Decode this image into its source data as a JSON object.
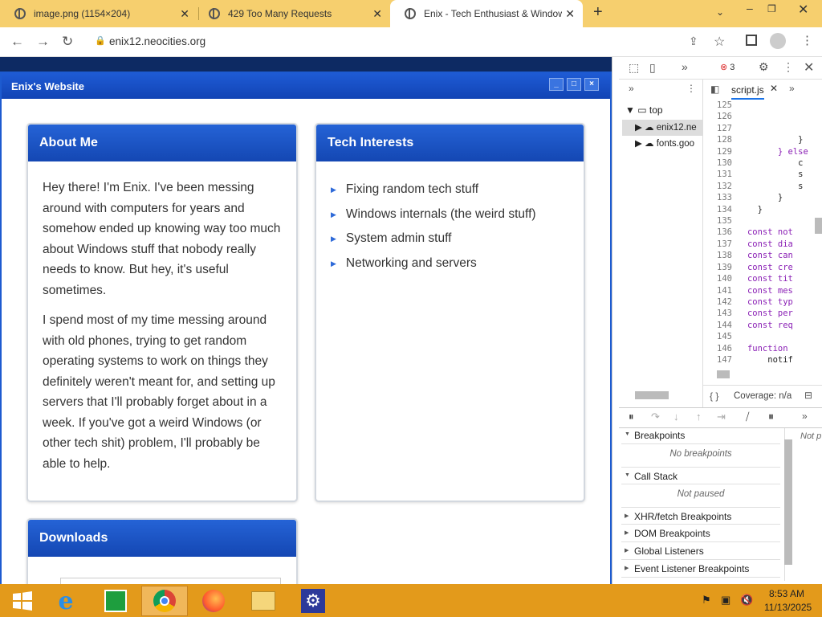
{
  "tabs": [
    {
      "title": "image.png (1154×204)",
      "close": "✕"
    },
    {
      "title": "429 Too Many Requests",
      "close": "✕"
    },
    {
      "title": "Enix - Tech Enthusiast & Window",
      "close": "✕"
    }
  ],
  "new_tab": "+",
  "address": {
    "url": "enix12.neocities.org"
  },
  "window": {
    "title": "Enix's Website",
    "min": "_",
    "max": "□",
    "close": "×"
  },
  "about": {
    "heading": "About Me",
    "p1": "Hey there! I'm Enix. I've been messing around with computers for years and somehow ended up knowing way too much about Windows stuff that nobody really needs to know. But hey, it's useful sometimes.",
    "p2": "I spend most of my time messing around with old phones, trying to get random operating systems to work on things they definitely weren't meant for, and setting up servers that I'll probably forget about in a week. If you've got a weird Windows (or other tech shit) problem, I'll probably be able to help."
  },
  "interests": {
    "heading": "Tech Interests",
    "items": [
      "Fixing random tech stuff",
      "Windows internals (the weird stuff)",
      "System admin stuff",
      "Networking and servers"
    ]
  },
  "downloads": {
    "heading": "Downloads"
  },
  "devtools": {
    "errors": "3",
    "file_tab": "script.js",
    "tree": [
      "top",
      "enix12.ne",
      "fonts.goo"
    ],
    "code_lines": [
      {
        "n": "125",
        "t": ""
      },
      {
        "n": "126",
        "t": ""
      },
      {
        "n": "127",
        "t": ""
      },
      {
        "n": "128",
        "t": "           }"
      },
      {
        "n": "129",
        "t": "       } else"
      },
      {
        "n": "130",
        "t": "           c"
      },
      {
        "n": "131",
        "t": "           s"
      },
      {
        "n": "132",
        "t": "           s"
      },
      {
        "n": "133",
        "t": "       }"
      },
      {
        "n": "134",
        "t": "   }"
      },
      {
        "n": "135",
        "t": ""
      },
      {
        "n": "136",
        "t": " const not"
      },
      {
        "n": "137",
        "t": " const dia"
      },
      {
        "n": "138",
        "t": " const can"
      },
      {
        "n": "139",
        "t": " const cre"
      },
      {
        "n": "140",
        "t": " const tit"
      },
      {
        "n": "141",
        "t": " const mes"
      },
      {
        "n": "142",
        "t": " const typ"
      },
      {
        "n": "143",
        "t": " const per"
      },
      {
        "n": "144",
        "t": " const req"
      },
      {
        "n": "145",
        "t": ""
      },
      {
        "n": "146",
        "t": " function"
      },
      {
        "n": "147",
        "t": "     notif"
      }
    ],
    "coverage": "Coverage: n/a",
    "breakpoints": "Breakpoints",
    "no_breakpoints": "No breakpoints",
    "call_stack": "Call Stack",
    "not_paused": "Not paused",
    "not_paused_short": "Not p",
    "sections": [
      "XHR/fetch Breakpoints",
      "DOM Breakpoints",
      "Global Listeners",
      "Event Listener Breakpoints"
    ]
  },
  "taskbar": {
    "time": "8:53 AM",
    "date": "11/13/2025"
  }
}
